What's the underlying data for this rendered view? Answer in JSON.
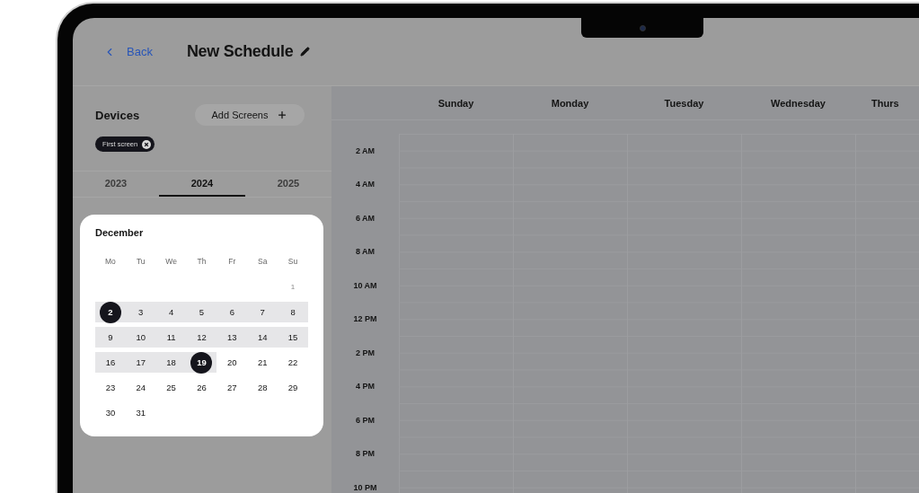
{
  "header": {
    "back": "Back",
    "title": "New Schedule"
  },
  "devices": {
    "title": "Devices",
    "add_button": "Add Screens",
    "chips": [
      {
        "label": "First screen"
      }
    ]
  },
  "year_tabs": [
    {
      "label": "2023",
      "selected": false
    },
    {
      "label": "2024",
      "selected": true
    },
    {
      "label": "2025",
      "selected": false
    }
  ],
  "calendar": {
    "month": "December",
    "weekdays": [
      "Mo",
      "Tu",
      "We",
      "Th",
      "Fr",
      "Sa",
      "Su"
    ],
    "weeks": [
      [
        {
          "kind": "blank"
        },
        {
          "kind": "blank"
        },
        {
          "kind": "blank"
        },
        {
          "kind": "blank"
        },
        {
          "kind": "blank"
        },
        {
          "kind": "blank"
        },
        {
          "kind": "day",
          "label": "1",
          "dimmed": true,
          "in_range": false,
          "selected": false
        }
      ],
      [
        {
          "kind": "day",
          "label": "2",
          "dimmed": false,
          "in_range": true,
          "selected": true
        },
        {
          "kind": "day",
          "label": "3",
          "dimmed": false,
          "in_range": true,
          "selected": false
        },
        {
          "kind": "day",
          "label": "4",
          "dimmed": false,
          "in_range": true,
          "selected": false
        },
        {
          "kind": "day",
          "label": "5",
          "dimmed": false,
          "in_range": true,
          "selected": false
        },
        {
          "kind": "day",
          "label": "6",
          "dimmed": false,
          "in_range": true,
          "selected": false
        },
        {
          "kind": "day",
          "label": "7",
          "dimmed": false,
          "in_range": true,
          "selected": false
        },
        {
          "kind": "day",
          "label": "8",
          "dimmed": false,
          "in_range": true,
          "selected": false
        }
      ],
      [
        {
          "kind": "day",
          "label": "9",
          "dimmed": false,
          "in_range": true,
          "selected": false
        },
        {
          "kind": "day",
          "label": "10",
          "dimmed": false,
          "in_range": true,
          "selected": false
        },
        {
          "kind": "day",
          "label": "11",
          "dimmed": false,
          "in_range": true,
          "selected": false
        },
        {
          "kind": "day",
          "label": "12",
          "dimmed": false,
          "in_range": true,
          "selected": false
        },
        {
          "kind": "day",
          "label": "13",
          "dimmed": false,
          "in_range": true,
          "selected": false
        },
        {
          "kind": "day",
          "label": "14",
          "dimmed": false,
          "in_range": true,
          "selected": false
        },
        {
          "kind": "day",
          "label": "15",
          "dimmed": false,
          "in_range": true,
          "selected": false
        }
      ],
      [
        {
          "kind": "day",
          "label": "16",
          "dimmed": false,
          "in_range": true,
          "selected": false
        },
        {
          "kind": "day",
          "label": "17",
          "dimmed": false,
          "in_range": true,
          "selected": false
        },
        {
          "kind": "day",
          "label": "18",
          "dimmed": false,
          "in_range": true,
          "selected": false
        },
        {
          "kind": "day",
          "label": "19",
          "dimmed": false,
          "in_range": true,
          "selected": true
        },
        {
          "kind": "day",
          "label": "20",
          "dimmed": false,
          "in_range": false,
          "selected": false
        },
        {
          "kind": "day",
          "label": "21",
          "dimmed": false,
          "in_range": false,
          "selected": false
        },
        {
          "kind": "day",
          "label": "22",
          "dimmed": false,
          "in_range": false,
          "selected": false
        }
      ],
      [
        {
          "kind": "day",
          "label": "23",
          "dimmed": false,
          "in_range": false,
          "selected": false
        },
        {
          "kind": "day",
          "label": "24",
          "dimmed": false,
          "in_range": false,
          "selected": false
        },
        {
          "kind": "day",
          "label": "25",
          "dimmed": false,
          "in_range": false,
          "selected": false
        },
        {
          "kind": "day",
          "label": "26",
          "dimmed": false,
          "in_range": false,
          "selected": false
        },
        {
          "kind": "day",
          "label": "27",
          "dimmed": false,
          "in_range": false,
          "selected": false
        },
        {
          "kind": "day",
          "label": "28",
          "dimmed": false,
          "in_range": false,
          "selected": false
        },
        {
          "kind": "day",
          "label": "29",
          "dimmed": false,
          "in_range": false,
          "selected": false
        }
      ],
      [
        {
          "kind": "day",
          "label": "30",
          "dimmed": false,
          "in_range": false,
          "selected": false
        },
        {
          "kind": "day",
          "label": "31",
          "dimmed": false,
          "in_range": false,
          "selected": false
        }
      ]
    ]
  },
  "schedule": {
    "days": [
      "Sunday",
      "Monday",
      "Tuesday",
      "Wednesday",
      "Thurs"
    ],
    "times": [
      "2 AM",
      "4 AM",
      "6 AM",
      "8 AM",
      "10 AM",
      "12 PM",
      "2 PM",
      "4 PM",
      "6 PM",
      "8 PM",
      "10 PM"
    ]
  }
}
